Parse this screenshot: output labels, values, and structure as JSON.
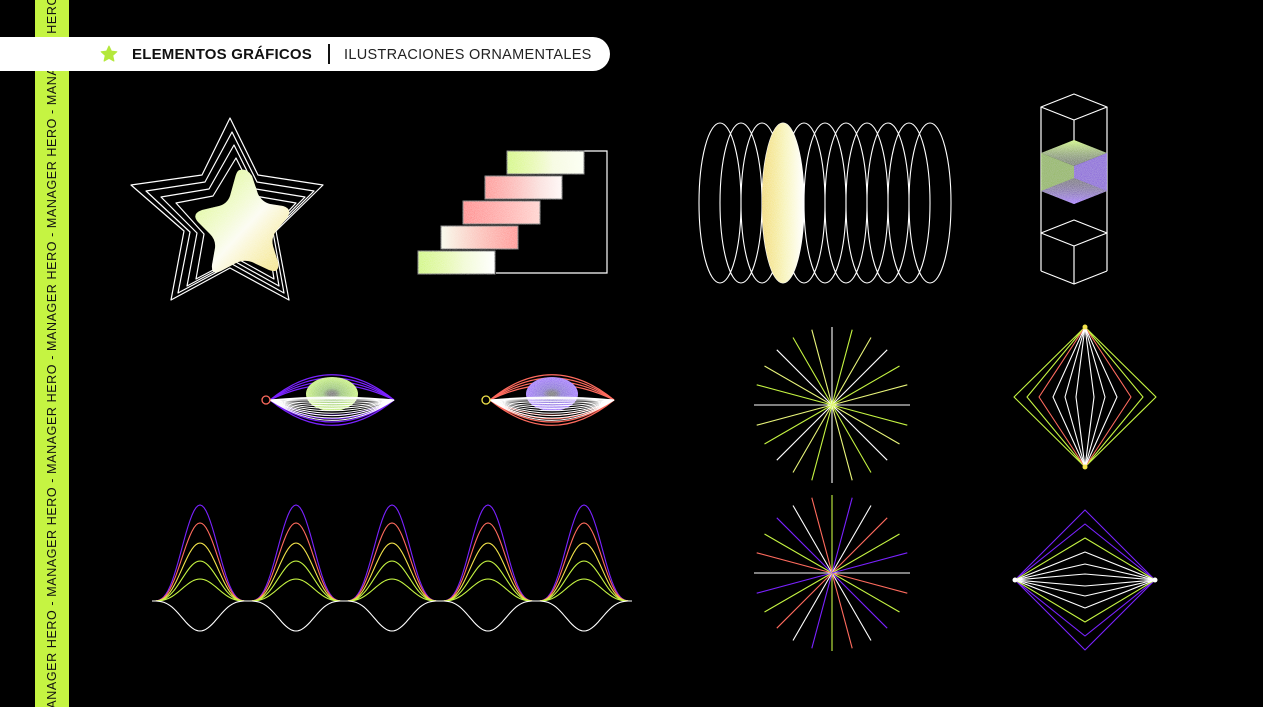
{
  "header": {
    "title": "ELEMENTOS GRÁFICOS",
    "subtitle": "ILUSTRACIONES ORNAMENTALES",
    "icon": "star-icon"
  },
  "side_strip": {
    "text": "MANAGER HERO  -  MANAGER HERO  -  MANAGER HERO  -  MANAGER HERO  -  MANAGER HERO  -  MANAGER HERO  -"
  },
  "colors": {
    "background": "#000000",
    "accent_lime": "#c5f442",
    "purple": "#7a22ff",
    "coral": "#ff6b5e",
    "yellow": "#f2e34a",
    "line": "#ffffff"
  }
}
